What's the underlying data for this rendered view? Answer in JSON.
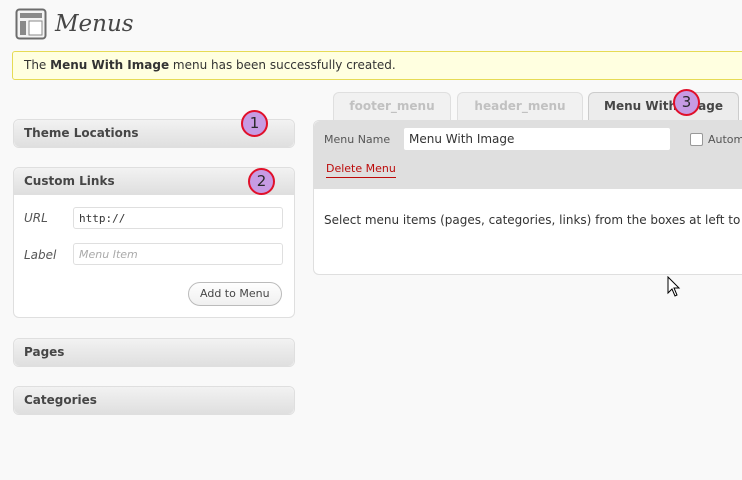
{
  "page": {
    "title": "Menus",
    "icon": "menus-icon"
  },
  "notice": {
    "prefix": "The ",
    "menu_name": "Menu With Image",
    "suffix": " menu has been successfully created."
  },
  "sidebar": {
    "theme_locations": {
      "title": "Theme Locations"
    },
    "custom_links": {
      "title": "Custom Links",
      "url_label": "URL",
      "url_value": "http://",
      "label_label": "Label",
      "label_placeholder": "Menu Item",
      "add_button": "Add to Menu"
    },
    "pages": {
      "title": "Pages"
    },
    "categories": {
      "title": "Categories"
    }
  },
  "tabs": [
    {
      "label": "footer_menu",
      "active": false
    },
    {
      "label": "header_menu",
      "active": false
    },
    {
      "label": "Menu With Image",
      "active": true
    }
  ],
  "editor": {
    "menu_name_label": "Menu Name",
    "menu_name_value": "Menu With Image",
    "auto_add_label": "Autom",
    "delete_link": "Delete Menu",
    "instructions": "Select menu items (pages, categories, links) from the boxes at left to b"
  },
  "markers": [
    "1",
    "2",
    "3"
  ],
  "colors": {
    "notice_bg": "#ffffe0",
    "notice_border": "#e6db55",
    "delete_red": "#bc0b0b",
    "marker_fill": "#c79be3",
    "marker_border": "#e0102a"
  }
}
